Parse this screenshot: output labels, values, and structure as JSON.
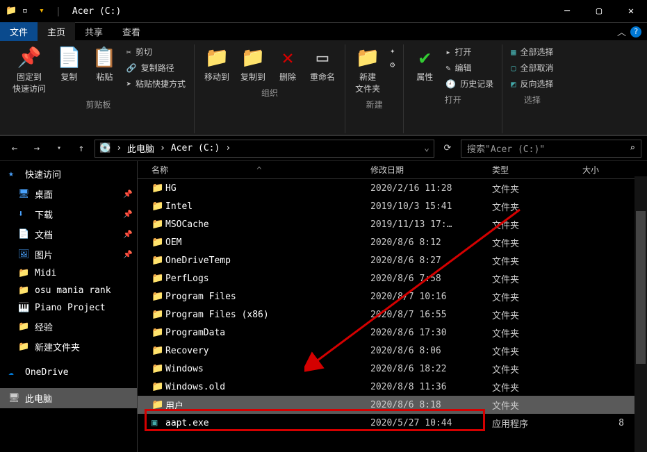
{
  "window": {
    "title": "Acer (C:)"
  },
  "menu": {
    "file": "文件",
    "home": "主页",
    "share": "共享",
    "view": "查看"
  },
  "ribbon": {
    "clipboard": {
      "pin": "固定到\n快速访问",
      "copy": "复制",
      "paste": "粘贴",
      "cut": "剪切",
      "copypath": "复制路径",
      "pasteshortcut": "粘贴快捷方式",
      "label": "剪贴板"
    },
    "organize": {
      "moveto": "移动到",
      "copyto": "复制到",
      "delete": "删除",
      "rename": "重命名",
      "label": "组织"
    },
    "new": {
      "newfolder": "新建\n文件夹",
      "label": "新建"
    },
    "open": {
      "properties": "属性",
      "open": "打开",
      "edit": "编辑",
      "history": "历史记录",
      "label": "打开"
    },
    "select": {
      "selectall": "全部选择",
      "selectnone": "全部取消",
      "invert": "反向选择",
      "label": "选择"
    }
  },
  "breadcrumb": {
    "root": "此电脑",
    "current": "Acer (C:)"
  },
  "search": {
    "placeholder": "搜索\"Acer (C:)\""
  },
  "sidebar": {
    "quickaccess": "快速访问",
    "desktop": "桌面",
    "downloads": "下载",
    "documents": "文档",
    "pictures": "图片",
    "midi": "Midi",
    "osumania": "osu mania rank",
    "piano": "Piano Project",
    "jingyan": "经验",
    "newfolder": "新建文件夹",
    "onedrive": "OneDrive",
    "thispc": "此电脑"
  },
  "columns": {
    "name": "名称",
    "date": "修改日期",
    "type": "类型",
    "size": "大小"
  },
  "folder_type": "文件夹",
  "app_type": "应用程序",
  "files": [
    {
      "icon": "folder",
      "name": "HG",
      "date": "2020/2/16 11:28",
      "type": "文件夹",
      "size": ""
    },
    {
      "icon": "folder",
      "name": "Intel",
      "date": "2019/10/3 15:41",
      "type": "文件夹",
      "size": ""
    },
    {
      "icon": "folder",
      "name": "MSOCache",
      "date": "2019/11/13 17:…",
      "type": "文件夹",
      "size": ""
    },
    {
      "icon": "folder",
      "name": "OEM",
      "date": "2020/8/6 8:12",
      "type": "文件夹",
      "size": ""
    },
    {
      "icon": "folder",
      "name": "OneDriveTemp",
      "date": "2020/8/6 8:27",
      "type": "文件夹",
      "size": ""
    },
    {
      "icon": "folder",
      "name": "PerfLogs",
      "date": "2020/8/6 7:58",
      "type": "文件夹",
      "size": ""
    },
    {
      "icon": "folder",
      "name": "Program Files",
      "date": "2020/8/7 10:16",
      "type": "文件夹",
      "size": ""
    },
    {
      "icon": "folder",
      "name": "Program Files (x86)",
      "date": "2020/8/7 16:55",
      "type": "文件夹",
      "size": ""
    },
    {
      "icon": "folder",
      "name": "ProgramData",
      "date": "2020/8/6 17:30",
      "type": "文件夹",
      "size": ""
    },
    {
      "icon": "folder",
      "name": "Recovery",
      "date": "2020/8/6 8:06",
      "type": "文件夹",
      "size": ""
    },
    {
      "icon": "folder",
      "name": "Windows",
      "date": "2020/8/6 18:22",
      "type": "文件夹",
      "size": ""
    },
    {
      "icon": "folder",
      "name": "Windows.old",
      "date": "2020/8/8 11:36",
      "type": "文件夹",
      "size": ""
    },
    {
      "icon": "folder",
      "name": "用户",
      "date": "2020/8/6 8:18",
      "type": "文件夹",
      "size": "",
      "selected": true
    },
    {
      "icon": "exe",
      "name": "aapt.exe",
      "date": "2020/5/27 10:44",
      "type": "应用程序",
      "size": "8"
    }
  ]
}
